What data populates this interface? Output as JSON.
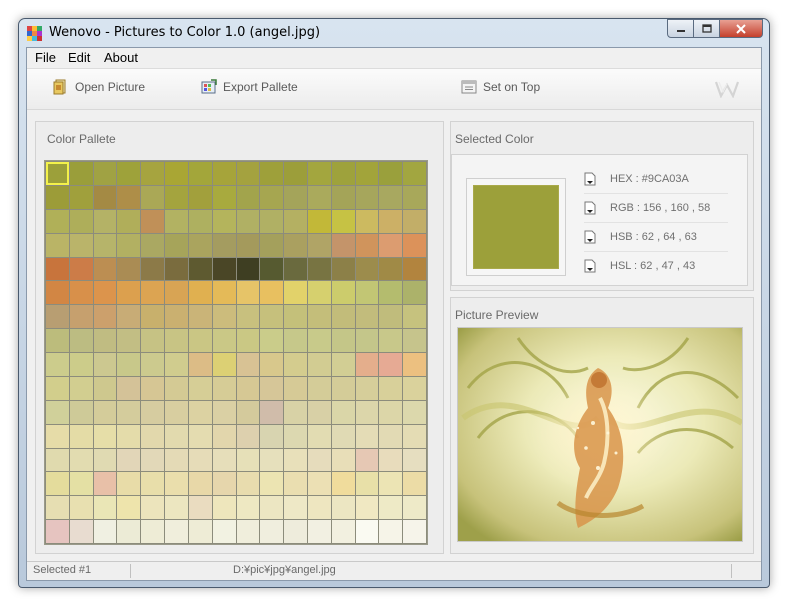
{
  "window": {
    "title": "Wenovo - Pictures to Color 1.0 (angel.jpg)",
    "controls": {
      "minimize": "minimize-icon",
      "maximize": "maximize-icon",
      "close": "close-icon"
    }
  },
  "menu": {
    "file": "File",
    "edit": "Edit",
    "about": "About"
  },
  "toolbar": {
    "open_label": "Open Picture",
    "export_label": "Export Pallete",
    "ontop_label": "Set on Top",
    "logo": "W"
  },
  "palette": {
    "title": "Color Pallete",
    "selected_index": 0,
    "colors": [
      "#9ca03a",
      "#9a9e3a",
      "#a0a243",
      "#9ea23a",
      "#a6a43f",
      "#a9a634",
      "#a3a63a",
      "#a6a43a",
      "#a4a23f",
      "#9ea03a",
      "#9c9e3a",
      "#a3a63e",
      "#9ea23c",
      "#a2a43a",
      "#9aa03c",
      "#a2a640",
      "#9c9c38",
      "#a0a03c",
      "#a48a44",
      "#ae8e48",
      "#aaa856",
      "#a4a43e",
      "#a2a03c",
      "#a8aa3e",
      "#a2a44c",
      "#a6a650",
      "#a4a45a",
      "#aaaa5c",
      "#a4a458",
      "#a6a65c",
      "#a8a860",
      "#a8a85a",
      "#b0b058",
      "#aeae5a",
      "#b4b266",
      "#b0ae5a",
      "#c09058",
      "#b2b262",
      "#aeb060",
      "#b4b45c",
      "#b0b064",
      "#b0b064",
      "#b4b062",
      "#c2b838",
      "#c6c244",
      "#ccba60",
      "#ccb066",
      "#c2ae68",
      "#bab466",
      "#bab46a",
      "#b6b46a",
      "#b2b062",
      "#aaa862",
      "#a6a45a",
      "#aaa45e",
      "#a49c60",
      "#a49a5c",
      "#a4a05c",
      "#aaa060",
      "#b0a466",
      "#c4946a",
      "#d0945c",
      "#dc9c70",
      "#dc925a",
      "#c8743c",
      "#cc7c48",
      "#bc8e52",
      "#aa8c54",
      "#8c7a48",
      "#7a6c3e",
      "#5e5a30",
      "#4a4626",
      "#3e3e22",
      "#565a30",
      "#6a6a3e",
      "#787442",
      "#8c8048",
      "#9c8c4c",
      "#a08a46",
      "#b2843e",
      "#d28644",
      "#d8904a",
      "#dc944c",
      "#dca04e",
      "#dca452",
      "#d8a454",
      "#e0b050",
      "#e4ba58",
      "#e6c468",
      "#e8c060",
      "#e2d26a",
      "#d6d06e",
      "#cccc6c",
      "#c2c674",
      "#b4bc6e",
      "#acb26a",
      "#b89e72",
      "#c6a06e",
      "#cca06c",
      "#c8ac76",
      "#c8b06c",
      "#cab070",
      "#cab478",
      "#ccbc7c",
      "#c8c07e",
      "#c6c07c",
      "#c4c07a",
      "#c4be7a",
      "#c2bc7a",
      "#c2bc7c",
      "#c0bc7c",
      "#c6c27e",
      "#bcbc7c",
      "#bcbc82",
      "#c0bc82",
      "#c2be84",
      "#c6c284",
      "#c8c484",
      "#cac684",
      "#cac886",
      "#cac884",
      "#cacc8a",
      "#c6c88a",
      "#c8ca8a",
      "#c4c688",
      "#c4c68a",
      "#c8c88a",
      "#c6c48c",
      "#cccc8c",
      "#cccc8a",
      "#ccc890",
      "#c8c88a",
      "#ccca8e",
      "#d0cc8e",
      "#dcbc86",
      "#dcd074",
      "#d8c294",
      "#d8c88c",
      "#d4cc8e",
      "#d2cc92",
      "#d2ce94",
      "#e4ae8c",
      "#e6aa94",
      "#ecc080",
      "#d2ce8c",
      "#d2ce90",
      "#cec88e",
      "#d4c298",
      "#d6c694",
      "#d4ca94",
      "#d6ce96",
      "#d6cc96",
      "#d6c894",
      "#d6c698",
      "#d6ca96",
      "#d4cc98",
      "#d4cc98",
      "#d6ce9a",
      "#d8d09a",
      "#dad29c",
      "#d0d09a",
      "#ceca98",
      "#d4cc9a",
      "#d4cc9c",
      "#d6cca0",
      "#d8cea0",
      "#dcd2a2",
      "#dad0a4",
      "#d4ca9c",
      "#d0bcaa",
      "#d8d2a6",
      "#d8d0a6",
      "#dad6a8",
      "#dcd6aa",
      "#dcd6a8",
      "#dcd8ac",
      "#e6dca8",
      "#e4dca6",
      "#e6dea8",
      "#e4dcaa",
      "#e2d8ac",
      "#e2daae",
      "#e4dcb0",
      "#e2d6ac",
      "#ddd0ae",
      "#d8d4b0",
      "#dcd8b0",
      "#e2dcb2",
      "#e0dab4",
      "#e4dcb6",
      "#e2dab4",
      "#e4dcb4",
      "#e0daae",
      "#e2dcb0",
      "#e0dab2",
      "#e2d6b8",
      "#e2d8b8",
      "#e4dab6",
      "#e6dcb8",
      "#e6deba",
      "#e6e0b8",
      "#e6e0bc",
      "#e8e0ba",
      "#e6dcbc",
      "#e8deb8",
      "#e6c8b4",
      "#e8dcbc",
      "#e6dec0",
      "#e4dc9c",
      "#e4e0a4",
      "#e8c0a8",
      "#e8dca8",
      "#e8deaa",
      "#eadeac",
      "#e8d8a8",
      "#e6d6ac",
      "#e8dcae",
      "#ece4b2",
      "#eadeb0",
      "#ece0b4",
      "#f0dc9c",
      "#e8e0a8",
      "#ece4b4",
      "#ecdca6",
      "#e6deb2",
      "#e8e0b0",
      "#eae6b6",
      "#eee4ac",
      "#ece4bc",
      "#ece6c0",
      "#eadcc0",
      "#eee6bc",
      "#eee8c2",
      "#ece6c2",
      "#eee8c6",
      "#eee6c0",
      "#ece6c2",
      "#f0e8c2",
      "#eeeac6",
      "#eeeac8",
      "#e6c4c0",
      "#e8dcd0",
      "#f0f0e2",
      "#ecebd6",
      "#eeecd6",
      "#f0eedc",
      "#eeecd6",
      "#f2f2e2",
      "#f0eedc",
      "#f0eede",
      "#eeecdc",
      "#f2f0e2",
      "#f2f0e0",
      "#fafaf2",
      "#f6f4e8",
      "#f6f4ea"
    ]
  },
  "selected": {
    "title": "Selected Color",
    "color": "#9CA03A",
    "hex": "HEX : #9CA03A",
    "rgb": "RGB : 156 , 160 , 58",
    "hsb": "HSB : 62 , 64 , 63",
    "hsl": "HSL : 62 , 47 , 43"
  },
  "preview": {
    "title": "Picture Preview",
    "image": "angel-illustration"
  },
  "status": {
    "selected": "Selected #1",
    "path": "D:¥pic¥jpg¥angel.jpg"
  }
}
